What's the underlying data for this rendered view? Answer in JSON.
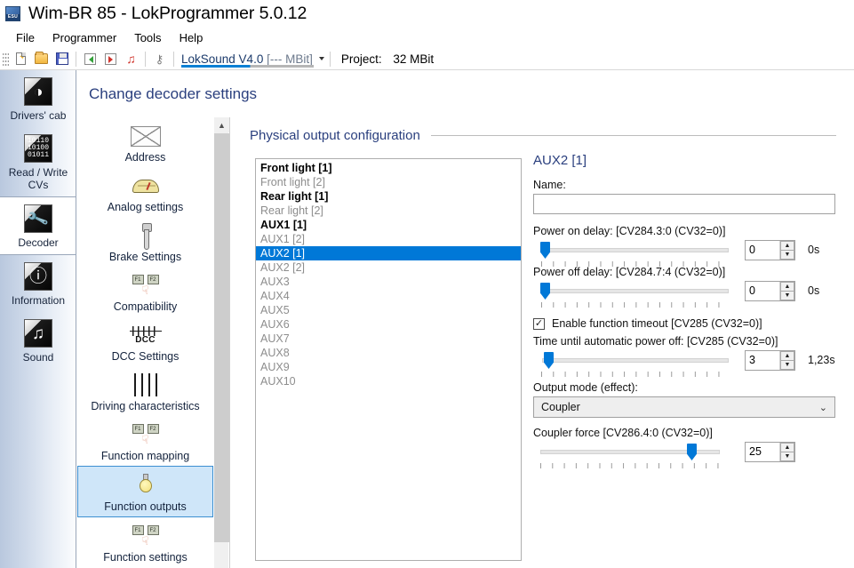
{
  "window": {
    "title": "Wim-BR 85 - LokProgrammer 5.0.12",
    "app_icon": "esu-logo-icon"
  },
  "menubar": {
    "items": [
      {
        "label": "File",
        "name": "menu-file"
      },
      {
        "label": "Programmer",
        "name": "menu-programmer"
      },
      {
        "label": "Tools",
        "name": "menu-tools"
      },
      {
        "label": "Help",
        "name": "menu-help"
      }
    ]
  },
  "toolbar": {
    "buttons": [
      {
        "name": "new-document-button",
        "icon": "new-document-icon"
      },
      {
        "name": "open-file-button",
        "icon": "open-folder-icon"
      },
      {
        "name": "save-file-button",
        "icon": "save-disk-icon"
      },
      {
        "name": "read-decoder-button",
        "icon": "arrow-in-green-icon"
      },
      {
        "name": "write-decoder-button",
        "icon": "arrow-out-red-icon"
      },
      {
        "name": "sound-transfer-button",
        "icon": "music-note-red-icon"
      },
      {
        "name": "identify-decoder-button",
        "icon": "key-icon"
      }
    ],
    "decoder_combo": {
      "label": "LokSound V4.0",
      "suffix": "[--- MBit]",
      "caret": "chevron-down-icon"
    },
    "project_label": "Project:",
    "project_value": "32 MBit"
  },
  "page": {
    "header": "Change decoder settings"
  },
  "rail": {
    "items": [
      {
        "label": "Drivers' cab",
        "icon": "speedometer-icon",
        "glyph": "◑",
        "active": false,
        "name": "rail-item-drivers-cab"
      },
      {
        "label": "Read / Write CVs",
        "icon": "binary-data-icon",
        "glyph": "",
        "active": false,
        "name": "rail-item-read-write-cvs"
      },
      {
        "label": "Decoder",
        "icon": "wrench-icon",
        "glyph": "🔧",
        "active": true,
        "name": "rail-item-decoder"
      },
      {
        "label": "Information",
        "icon": "info-circle-icon",
        "glyph": "ⓘ",
        "active": false,
        "name": "rail-item-information"
      },
      {
        "label": "Sound",
        "icon": "music-notes-icon",
        "glyph": "♪♫",
        "active": false,
        "name": "rail-item-sound"
      }
    ]
  },
  "nav2": {
    "items": [
      {
        "label": "Address",
        "icon": "envelope-icon",
        "selected": false,
        "name": "nav-item-address"
      },
      {
        "label": "Analog settings",
        "icon": "analog-gauge-icon",
        "selected": false,
        "name": "nav-item-analog-settings"
      },
      {
        "label": "Brake Settings",
        "icon": "brake-lever-icon",
        "selected": false,
        "name": "nav-item-brake-settings"
      },
      {
        "label": "Compatibility",
        "icon": "function-keys-hand-icon",
        "selected": false,
        "name": "nav-item-compatibility"
      },
      {
        "label": "DCC Settings",
        "icon": "dcc-waveform-icon",
        "selected": false,
        "name": "nav-item-dcc-settings"
      },
      {
        "label": "Driving characteristics",
        "icon": "sliders-icon",
        "selected": false,
        "name": "nav-item-driving-characteristics"
      },
      {
        "label": "Function mapping",
        "icon": "function-keys-hand-icon",
        "selected": false,
        "name": "nav-item-function-mapping"
      },
      {
        "label": "Function outputs",
        "icon": "light-bulb-icon",
        "selected": true,
        "name": "nav-item-function-outputs"
      },
      {
        "label": "Function settings",
        "icon": "function-keys-hand-icon",
        "selected": false,
        "name": "nav-item-function-settings"
      }
    ],
    "scroll_up_icon": "chevron-up-icon"
  },
  "main": {
    "group_title": "Physical output configuration",
    "outputs": [
      {
        "label": "Front light [1]",
        "state": "enabled"
      },
      {
        "label": "Front light [2]",
        "state": "disabled"
      },
      {
        "label": "Rear light [1]",
        "state": "enabled"
      },
      {
        "label": "Rear light [2]",
        "state": "disabled"
      },
      {
        "label": "AUX1 [1]",
        "state": "enabled"
      },
      {
        "label": "AUX1 [2]",
        "state": "disabled"
      },
      {
        "label": "AUX2 [1]",
        "state": "selected"
      },
      {
        "label": "AUX2 [2]",
        "state": "disabled"
      },
      {
        "label": "AUX3",
        "state": "disabled"
      },
      {
        "label": "AUX4",
        "state": "disabled"
      },
      {
        "label": "AUX5",
        "state": "disabled"
      },
      {
        "label": "AUX6",
        "state": "disabled"
      },
      {
        "label": "AUX7",
        "state": "disabled"
      },
      {
        "label": "AUX8",
        "state": "disabled"
      },
      {
        "label": "AUX9",
        "state": "disabled"
      },
      {
        "label": "AUX10",
        "state": "disabled"
      }
    ],
    "detail": {
      "title": "AUX2 [1]",
      "name_label": "Name:",
      "name_value": "",
      "name_placeholder": "",
      "power_on_delay": {
        "label": "Power on delay: [CV284.3:0 (CV32=0)]",
        "value": "0",
        "unit": "0s",
        "percent": 0
      },
      "power_off_delay": {
        "label": "Power off delay: [CV284.7:4 (CV32=0)]",
        "value": "0",
        "unit": "0s",
        "percent": 0
      },
      "enable_timeout": {
        "label": "Enable function timeout [CV285 (CV32=0)]",
        "checked": true,
        "check_glyph": "✓"
      },
      "auto_power_off": {
        "label": "Time until automatic power off: [CV285 (CV32=0)]",
        "value": "3",
        "unit": "1,23s",
        "percent": 2
      },
      "output_mode": {
        "label": "Output mode (effect):",
        "value": "Coupler",
        "chevron": "chevron-down-icon"
      },
      "coupler_force": {
        "label": "Coupler force [CV286.4:0 (CV32=0)]",
        "value": "25",
        "unit": "",
        "percent": 79
      },
      "spinner_up": "▲",
      "spinner_down": "▼"
    }
  },
  "colors": {
    "accent": "#0078d7",
    "header_text": "#2a3f7e",
    "selection": "#0078d7",
    "nav_selected_bg": "#cfe6f9"
  }
}
